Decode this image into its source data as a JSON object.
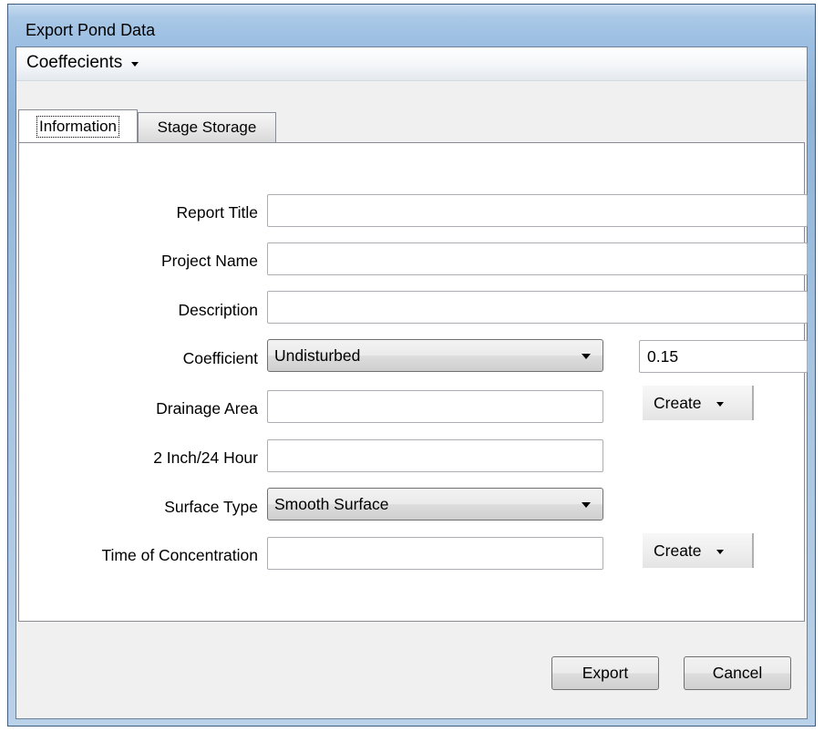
{
  "window": {
    "title": "Export Pond Data"
  },
  "menu": {
    "coefficients_label": "Coeffecients"
  },
  "tabs": [
    {
      "label": "Information",
      "selected": true
    },
    {
      "label": "Stage Storage",
      "selected": false
    }
  ],
  "form": {
    "report_title": {
      "label": "Report Title",
      "value": ""
    },
    "project_name": {
      "label": "Project Name",
      "value": ""
    },
    "description": {
      "label": "Description",
      "value": ""
    },
    "coefficient": {
      "label": "Coefficient",
      "selected": "Undisturbed",
      "value": "0.15"
    },
    "drainage_area": {
      "label": "Drainage Area",
      "value": "",
      "create_label": "Create"
    },
    "two_inch": {
      "label": "2 Inch/24 Hour",
      "value": ""
    },
    "surface_type": {
      "label": "Surface Type",
      "selected": "Smooth Surface"
    },
    "time_of_concentration": {
      "label": "Time of Concentration",
      "value": "",
      "create_label": "Create"
    }
  },
  "buttons": {
    "export_label": "Export",
    "cancel_label": "Cancel"
  }
}
